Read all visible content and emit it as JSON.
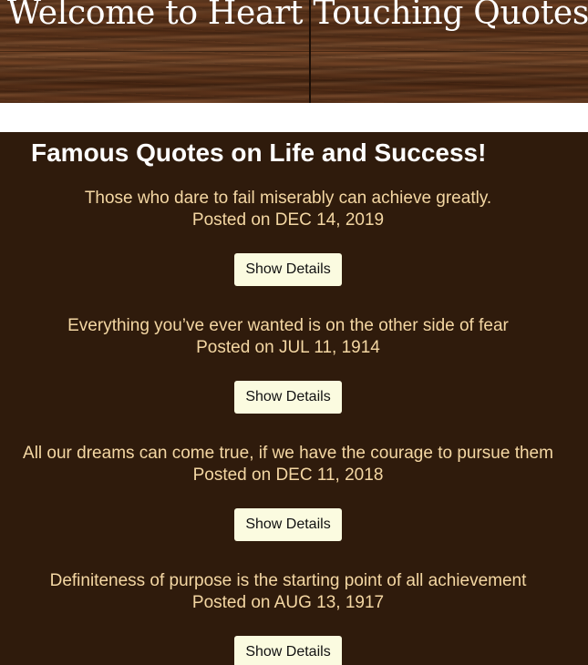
{
  "header": {
    "title": "Welcome to Heart Touching Quotes!"
  },
  "main": {
    "heading": "Famous Quotes on Life and Success!",
    "quotes": [
      {
        "text": "Those who dare to fail miserably can achieve greatly.",
        "date": "Posted on DEC 14, 2019",
        "button_label": "Show Details"
      },
      {
        "text": "Everything you’ve ever wanted is on the other side of fear",
        "date": "Posted on JUL 11, 1914",
        "button_label": "Show Details"
      },
      {
        "text": "All our dreams can come true, if we have the courage to pursue them",
        "date": "Posted on DEC 11, 2018",
        "button_label": "Show Details"
      },
      {
        "text": "Definiteness of purpose is the starting point of all achievement",
        "date": "Posted on AUG 13, 1917",
        "button_label": "Show Details"
      }
    ]
  },
  "colors": {
    "panel_background": "#2f1b0c",
    "quote_text": "#f4d7a3",
    "button_background": "#fbfbe0",
    "heading_text": "#ffffff"
  }
}
